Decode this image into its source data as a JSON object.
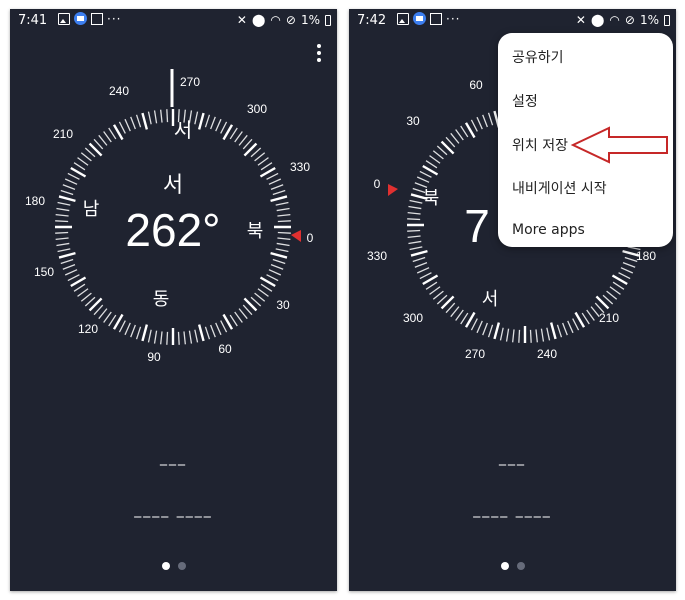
{
  "left": {
    "status": {
      "time": "7:41",
      "battery": "1%"
    },
    "compass": {
      "heading_label": "서",
      "heading_degrees": "262°",
      "ring_dirs": {
        "top": "서",
        "right": "북",
        "bottom": "동",
        "left": "남"
      },
      "degree_labels": [
        "270",
        "300",
        "330",
        "0",
        "30",
        "60",
        "90",
        "120",
        "150",
        "180",
        "210",
        "240"
      ]
    },
    "readout": {
      "line1": "___",
      "line2": "____ ____"
    }
  },
  "right": {
    "status": {
      "time": "7:42",
      "battery": "1%"
    },
    "compass": {
      "heading_partial": "7",
      "ring_dirs": {
        "left": "북",
        "bottom": "서"
      },
      "degree_labels": [
        "60",
        "30",
        "0",
        "330",
        "300",
        "270",
        "240",
        "210",
        "180"
      ]
    },
    "menu": {
      "items": [
        "공유하기",
        "설정",
        "위치 저장",
        "내비게이션 시작",
        "More apps"
      ]
    },
    "readout": {
      "line1": "___",
      "line2": "____ ____"
    }
  },
  "colors": {
    "background": "#1f2330",
    "marker": "#e03030",
    "arrow": "#c62828"
  }
}
